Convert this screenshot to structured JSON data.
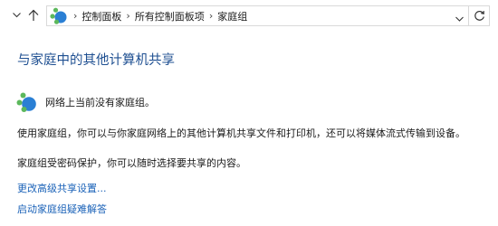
{
  "address_bar": {
    "breadcrumb": [
      "控制面板",
      "所有控制面板项",
      "家庭组"
    ]
  },
  "icons": {
    "up": "up-arrow-icon",
    "homegroup": "homegroup-icon",
    "separator": "chevron-right-icon",
    "dropdown": "chevron-down-icon",
    "refresh": "refresh-icon"
  },
  "colors": {
    "title": "#1e4f91",
    "link": "#1a62b8",
    "icon_green": "#5cb85c",
    "icon_blue": "#2a7fd4"
  },
  "main": {
    "title": "与家庭中的其他计算机共享",
    "status": "网络上当前没有家庭组。",
    "description": "使用家庭组，你可以与你家庭网络上的其他计算机共享文件和打印机，还可以将媒体流式传输到设备。",
    "password_note": "家庭组受密码保护，你可以随时选择要共享的内容。",
    "links": [
      "更改高级共享设置...",
      "启动家庭组疑难解答"
    ]
  }
}
